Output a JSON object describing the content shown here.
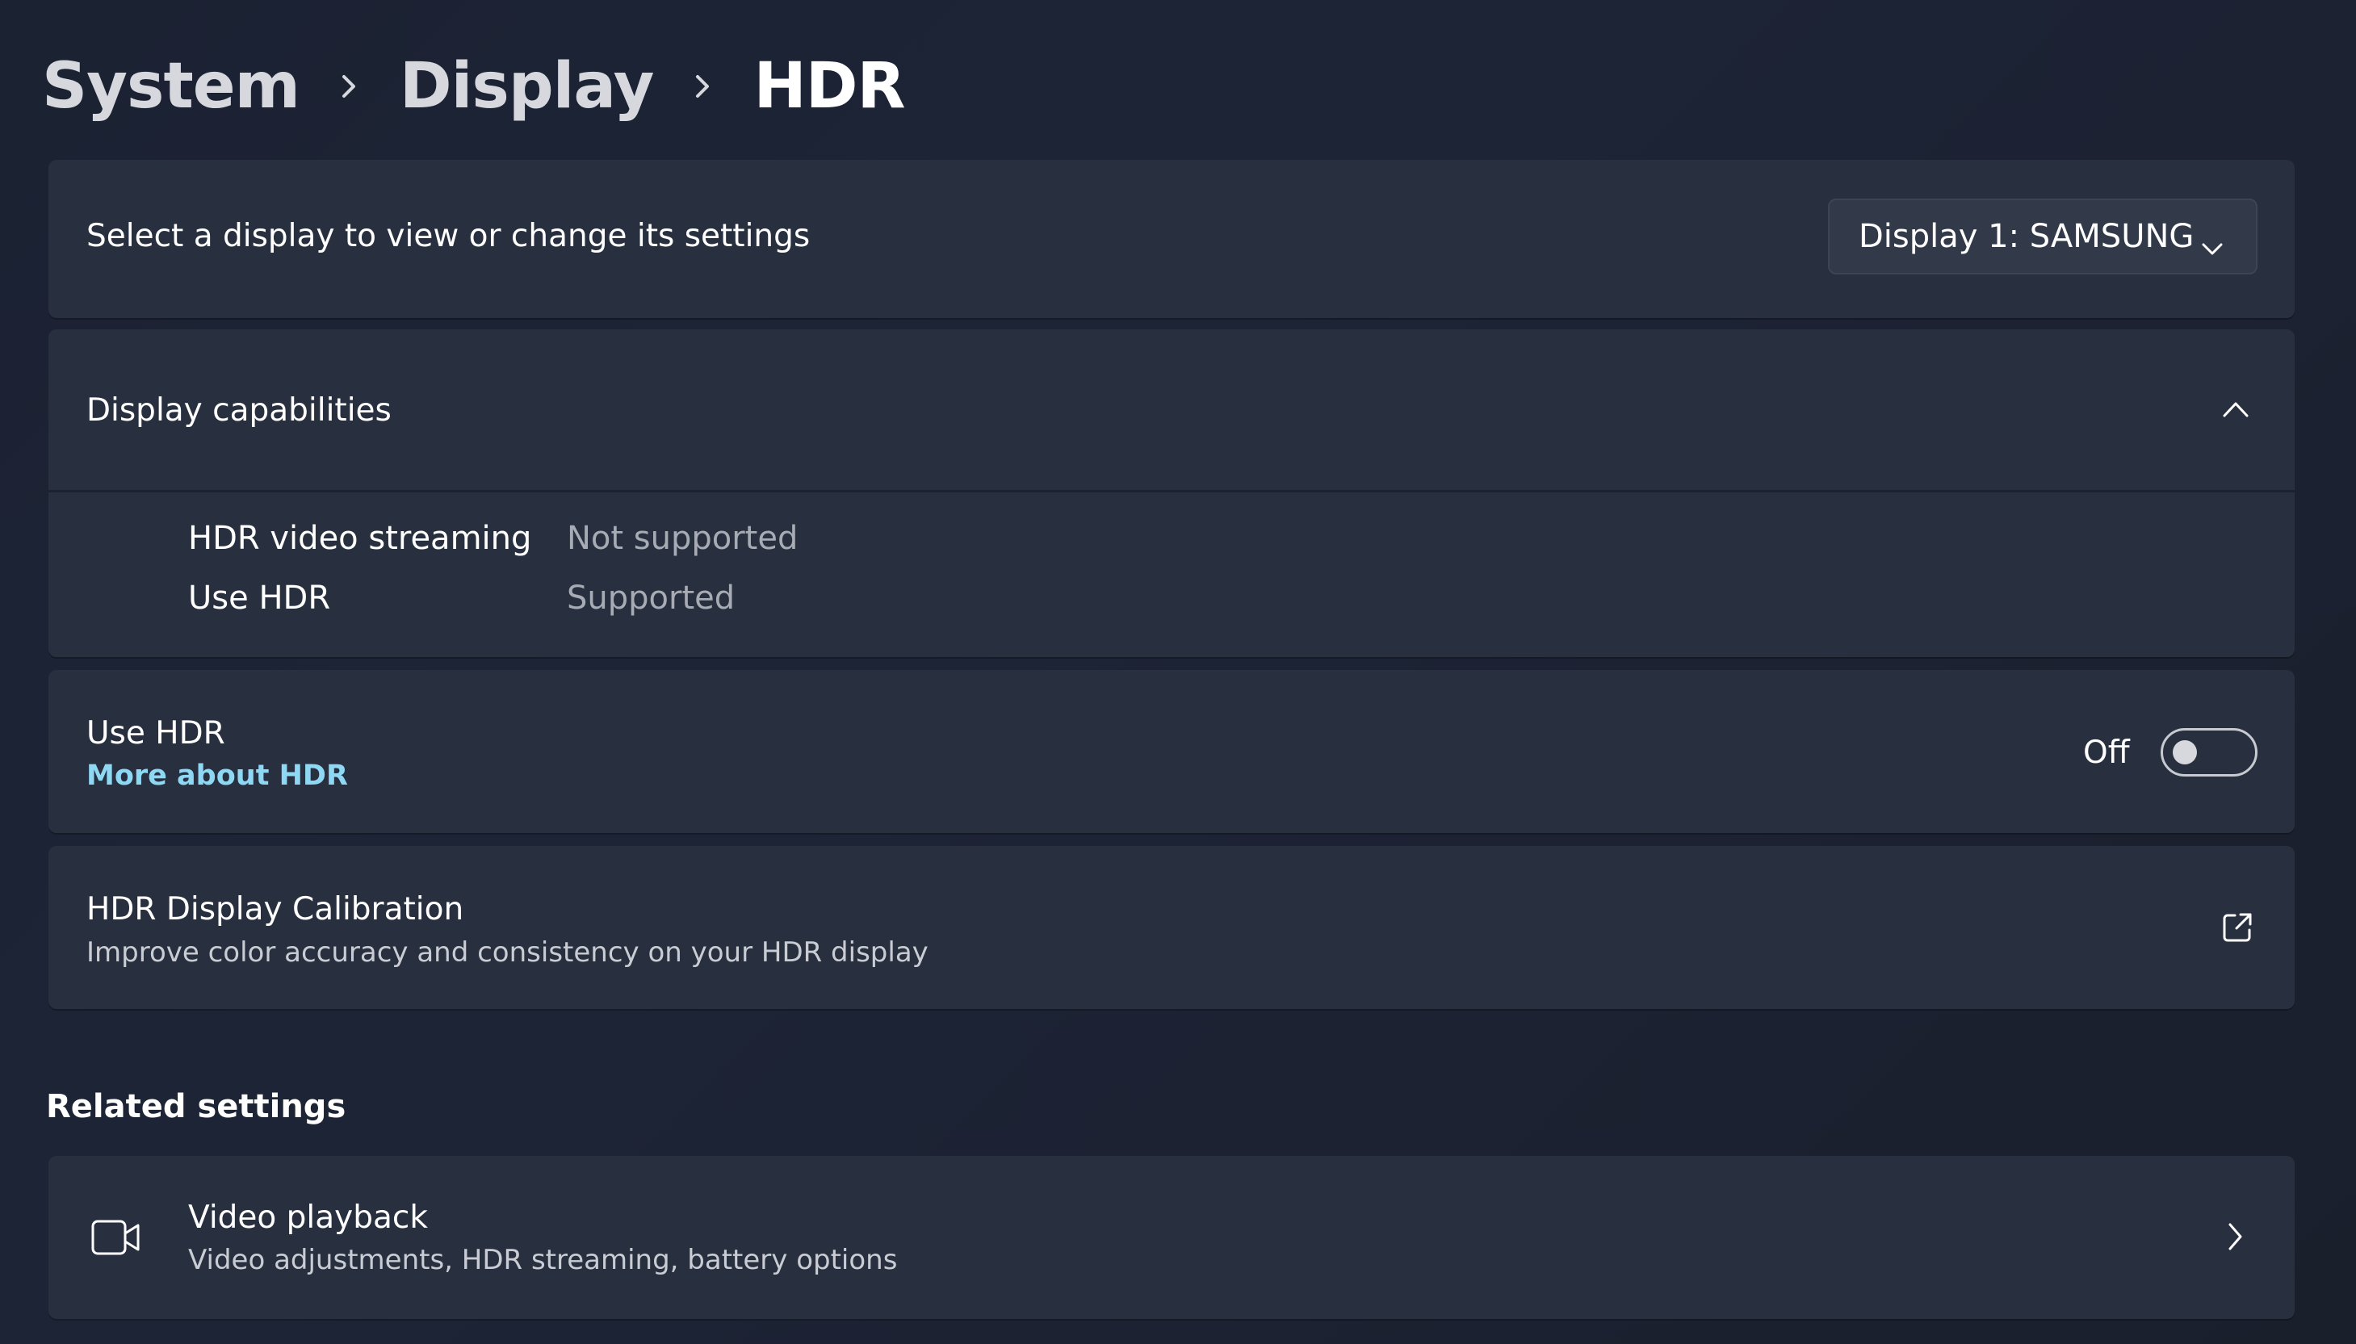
{
  "breadcrumb": {
    "items": [
      "System",
      "Display",
      "HDR"
    ]
  },
  "display_select": {
    "label": "Select a display to view or change its settings",
    "selected": "Display 1: SAMSUNG"
  },
  "capabilities": {
    "title": "Display capabilities",
    "rows": [
      {
        "label": "HDR video streaming",
        "value": "Not supported"
      },
      {
        "label": "Use HDR",
        "value": "Supported"
      }
    ]
  },
  "use_hdr": {
    "title": "Use HDR",
    "link": "More about HDR",
    "state_label": "Off",
    "enabled": false
  },
  "calibration": {
    "title": "HDR Display Calibration",
    "description": "Improve color accuracy and consistency on your HDR display"
  },
  "related": {
    "title": "Related settings",
    "items": [
      {
        "title": "Video playback",
        "description": "Video adjustments, HDR streaming, battery options",
        "icon": "video-camera-icon"
      }
    ]
  },
  "colors": {
    "card": "#283040",
    "link": "#8ed8f4",
    "secondary_text": "#a7abb4"
  }
}
